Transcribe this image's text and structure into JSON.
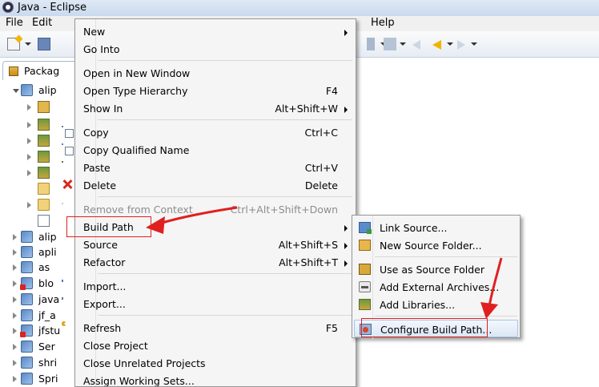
{
  "window": {
    "title": "Java - Eclipse"
  },
  "menubar": {
    "items": [
      "File",
      "Edit",
      "Help"
    ]
  },
  "explorer": {
    "tab_label": "Packag",
    "rows": [
      {
        "label": "alip",
        "icon": "java-project-icon"
      },
      {
        "label": "",
        "icon": "package-icon"
      },
      {
        "label": "",
        "icon": "library-icon"
      },
      {
        "label": "",
        "icon": "library-icon"
      },
      {
        "label": "",
        "icon": "library-icon"
      },
      {
        "label": "",
        "icon": "library-icon"
      },
      {
        "label": "",
        "icon": "folder-icon"
      },
      {
        "label": "",
        "icon": "folder-icon"
      },
      {
        "label": "",
        "icon": "file-icon"
      },
      {
        "label": "alip",
        "icon": "java-project-icon"
      },
      {
        "label": "apli",
        "icon": "java-project-icon"
      },
      {
        "label": "as",
        "icon": "java-project-icon"
      },
      {
        "label": "blo",
        "icon": "java-project-error-icon"
      },
      {
        "label": "java",
        "icon": "java-project-icon"
      },
      {
        "label": "jf_a",
        "icon": "java-project-icon"
      },
      {
        "label": "jfstu",
        "icon": "java-project-error-icon"
      },
      {
        "label": "Ser",
        "icon": "java-project-icon"
      },
      {
        "label": "shri",
        "icon": "java-project-icon"
      },
      {
        "label": "Spri",
        "icon": "java-project-icon"
      }
    ]
  },
  "context_menu": {
    "items": [
      {
        "label": "New",
        "shortcut": "",
        "submenu": true
      },
      {
        "label": "Go Into",
        "shortcut": ""
      },
      {
        "label": "Open in New Window",
        "shortcut": ""
      },
      {
        "label": "Open Type Hierarchy",
        "shortcut": "F4"
      },
      {
        "label": "Show In",
        "shortcut": "Alt+Shift+W",
        "submenu": true
      },
      {
        "label": "Copy",
        "shortcut": "Ctrl+C",
        "icon": "copy-icon"
      },
      {
        "label": "Copy Qualified Name",
        "shortcut": "",
        "icon": "copy-qualified-icon"
      },
      {
        "label": "Paste",
        "shortcut": "Ctrl+V",
        "icon": "paste-icon"
      },
      {
        "label": "Delete",
        "shortcut": "Delete",
        "icon": "delete-icon"
      },
      {
        "label": "Remove from Context",
        "shortcut": "Ctrl+Alt+Shift+Down",
        "disabled": true,
        "icon": "remove-context-icon"
      },
      {
        "label": "Build Path",
        "shortcut": "",
        "submenu": true,
        "highlighted": true
      },
      {
        "label": "Source",
        "shortcut": "Alt+Shift+S",
        "submenu": true
      },
      {
        "label": "Refactor",
        "shortcut": "Alt+Shift+T",
        "submenu": true
      },
      {
        "label": "Import...",
        "shortcut": "",
        "icon": "import-icon"
      },
      {
        "label": "Export...",
        "shortcut": "",
        "icon": "export-icon"
      },
      {
        "label": "Refresh",
        "shortcut": "F5",
        "icon": "refresh-icon"
      },
      {
        "label": "Close Project",
        "shortcut": ""
      },
      {
        "label": "Close Unrelated Projects",
        "shortcut": ""
      },
      {
        "label": "Assign Working Sets...",
        "shortcut": ""
      }
    ]
  },
  "build_path_submenu": {
    "items": [
      {
        "label": "Link Source...",
        "icon": "link-source-icon"
      },
      {
        "label": "New Source Folder...",
        "icon": "new-source-folder-icon"
      },
      {
        "label": "Use as Source Folder",
        "icon": "source-folder-icon"
      },
      {
        "label": "Add External Archives...",
        "icon": "jar-icon"
      },
      {
        "label": "Add Libraries...",
        "icon": "libraries-icon"
      },
      {
        "label": "Configure Build Path...",
        "icon": "configure-build-path-icon",
        "highlighted": true
      }
    ]
  },
  "colors": {
    "annotation_red": "#e02020",
    "highlight": "#dbe7f6"
  }
}
